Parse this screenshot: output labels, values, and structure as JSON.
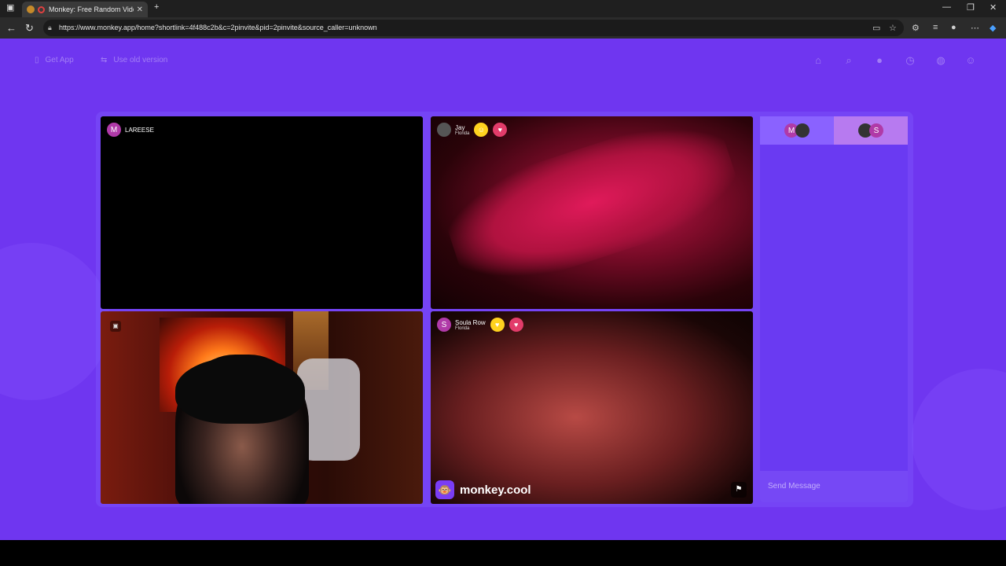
{
  "browser": {
    "tab_title": "Monkey: Free Random Vide",
    "url": "https://www.monkey.app/home?shortlink=4f488c2b&c=2pinvite&pid=2pinvite&source_caller=unknown"
  },
  "header": {
    "get_app": "Get App",
    "old_version": "Use old version"
  },
  "tiles": [
    {
      "avatar": "M",
      "name": "LAREESE",
      "location": ""
    },
    {
      "avatar": "",
      "name": "Jay",
      "location": "Florida"
    },
    {
      "avatar": "",
      "name": "",
      "location": ""
    },
    {
      "avatar": "S",
      "name": "Soula Row",
      "location": "Florida"
    }
  ],
  "brand": {
    "logo": "🐵",
    "name": "monkey.cool"
  },
  "chat": {
    "tab1_letter": "M",
    "tab2_letter": "S",
    "placeholder": "Send Message"
  },
  "colors": {
    "page_bg": "#6f36f0",
    "chat_tab_active": "#8a62ff",
    "chat_tab_other": "#b77af0"
  }
}
